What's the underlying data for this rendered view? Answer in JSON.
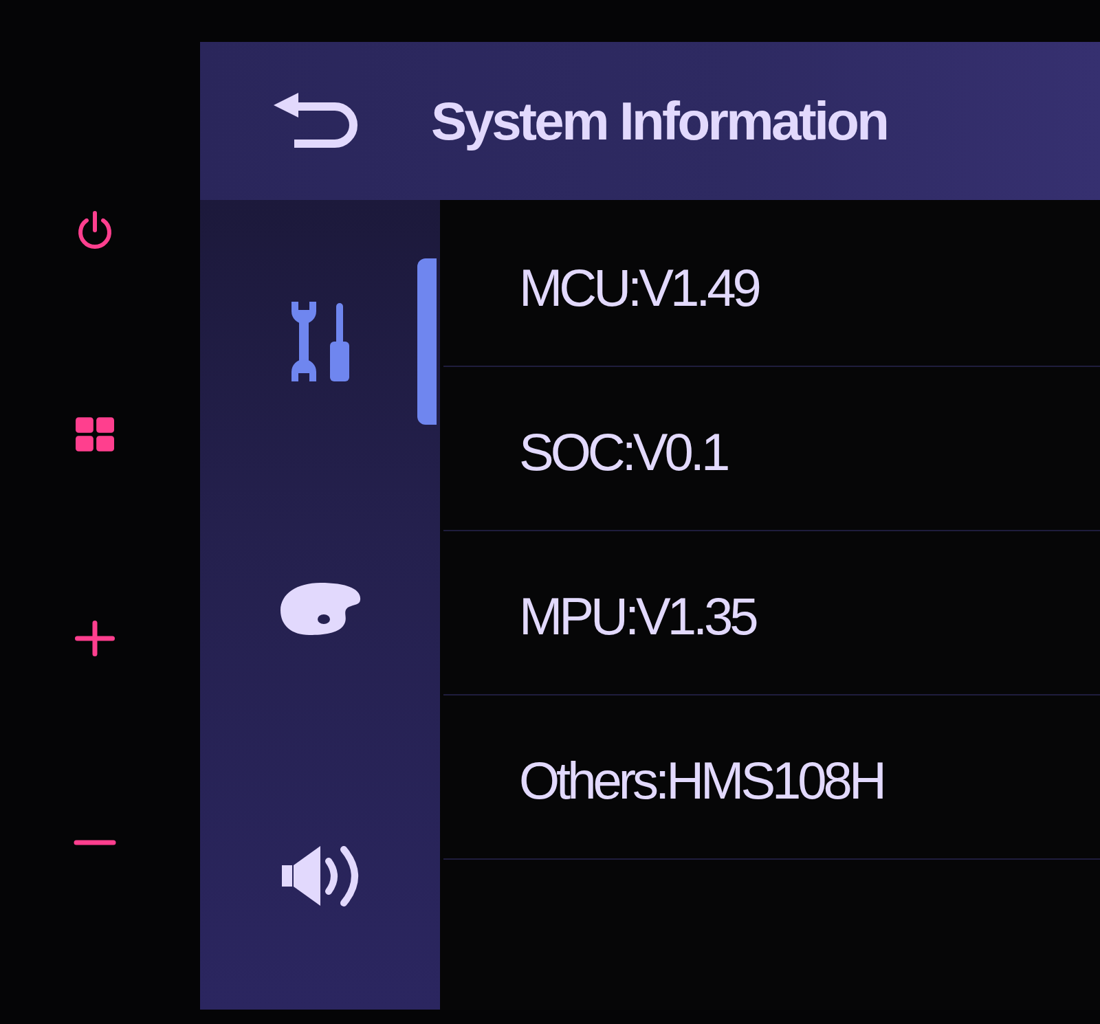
{
  "hardware_buttons": [
    {
      "kind": "power"
    },
    {
      "kind": "menu"
    },
    {
      "kind": "volume_up"
    },
    {
      "kind": "volume_down"
    }
  ],
  "header": {
    "title": "System Information"
  },
  "sidebar": {
    "items": [
      {
        "kind": "tools",
        "selected": true
      },
      {
        "kind": "palette",
        "selected": false
      },
      {
        "kind": "sound",
        "selected": false
      }
    ]
  },
  "info_rows": [
    {
      "text": "MCU:V1.49"
    },
    {
      "text": "SOC:V0.1"
    },
    {
      "text": "MPU:V1.35"
    },
    {
      "text": "Others:HMS108H"
    }
  ]
}
